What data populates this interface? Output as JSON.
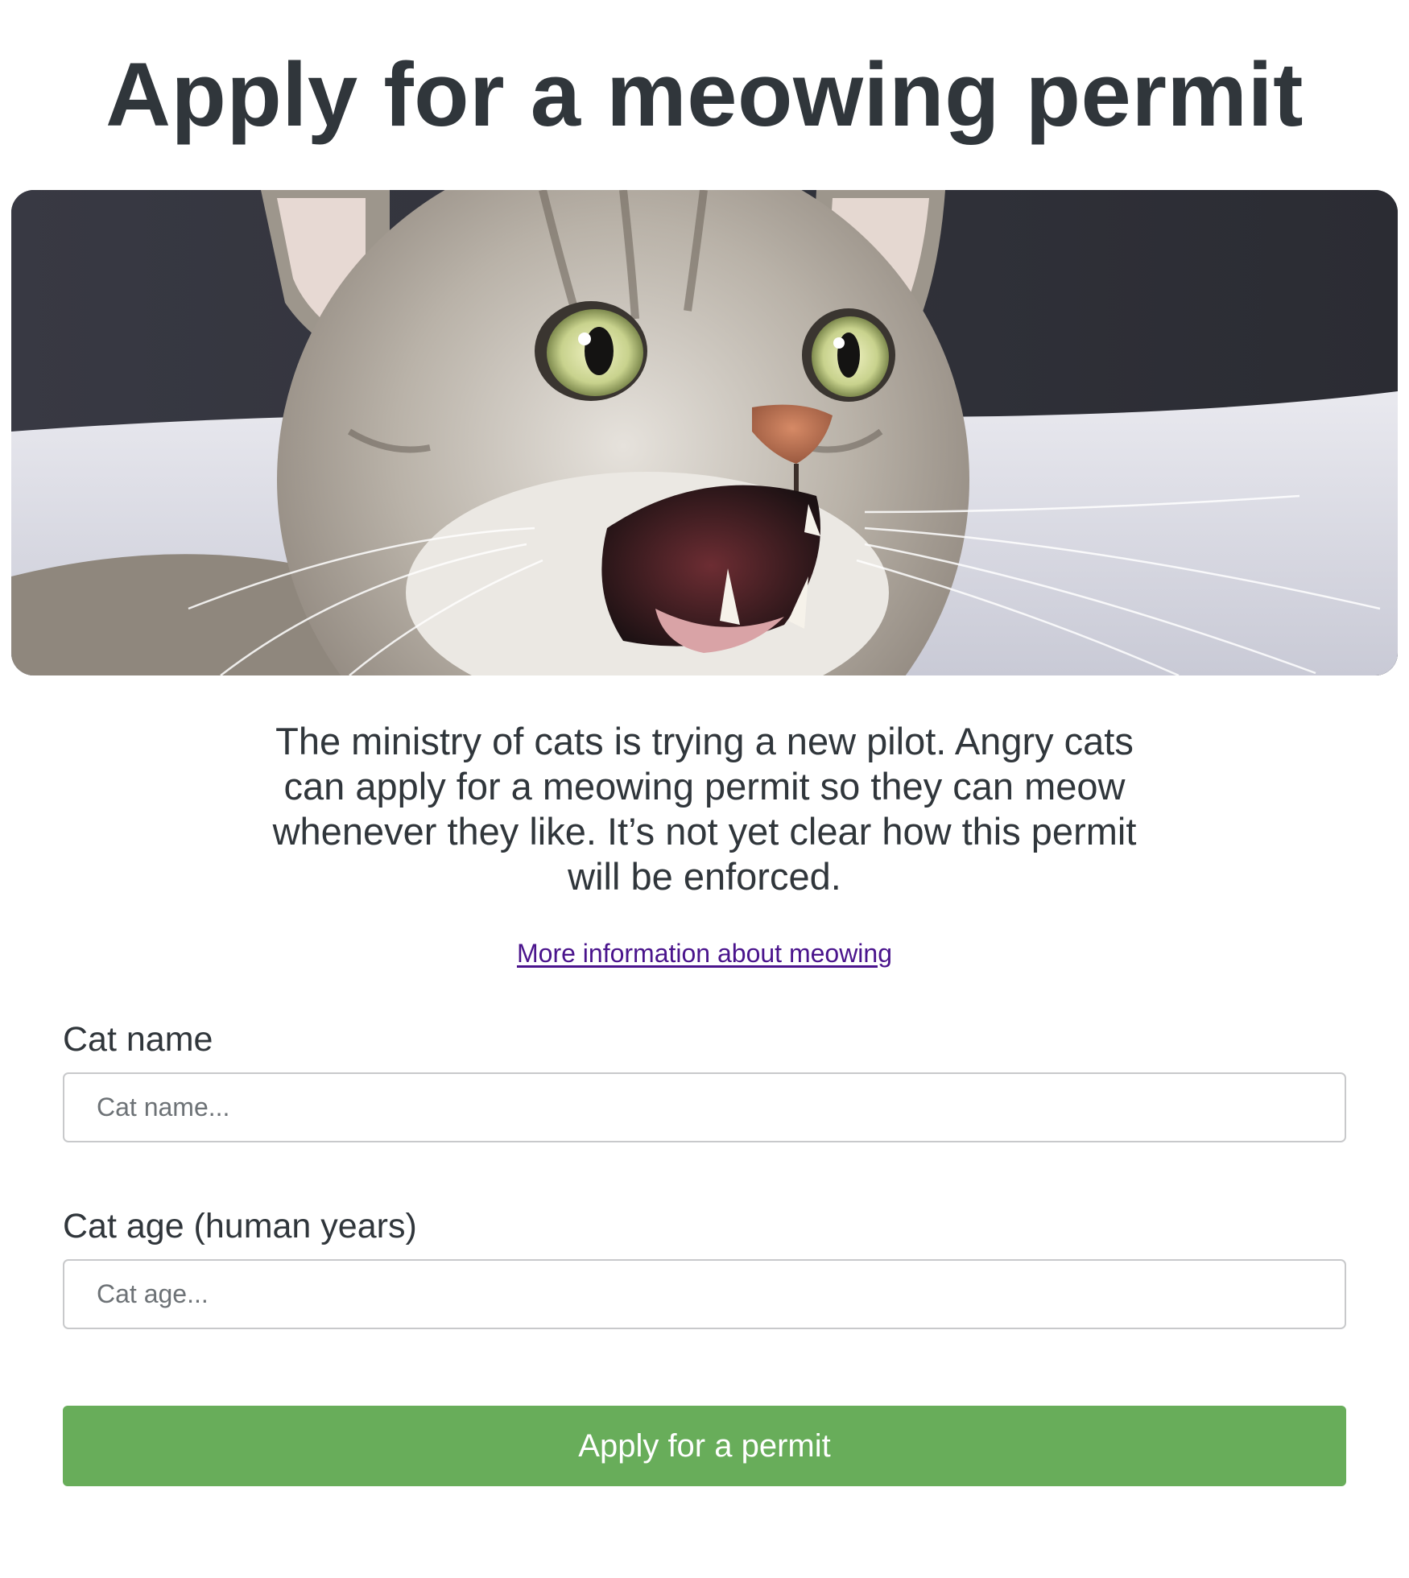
{
  "page": {
    "title": "Apply for a meowing permit"
  },
  "hero": {
    "image": "angry-meowing-cat-photo"
  },
  "intro": {
    "text": "The ministry of cats is trying a new pilot. Angry cats can apply for a meowing permit so they can meow whenever they like. It’s not yet clear how this permit will be enforced."
  },
  "links": {
    "more_info": "More information about meowing"
  },
  "form": {
    "name_label": "Cat name",
    "name_placeholder": "Cat name...",
    "name_value": "",
    "age_label": "Cat age (human years)",
    "age_placeholder": "Cat age...",
    "age_value": "",
    "submit_label": "Apply for a permit"
  },
  "colors": {
    "text": "#30363b",
    "link": "#4a148c",
    "button": "#68ad5a",
    "button_text": "#ffffff",
    "input_border": "#c8c9cb"
  }
}
